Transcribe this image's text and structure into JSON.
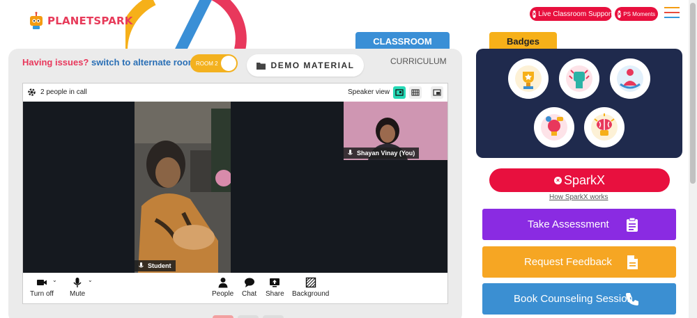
{
  "header": {
    "logo_text_1": "PLANET",
    "logo_text_2": "SPARK",
    "live_support_label": "Live Classroom Support",
    "ps_moments_label": "PS Moments",
    "close_glyph": "×"
  },
  "classroom": {
    "tab_label": "CLASSROOM",
    "issue_question": "Having issues?",
    "issue_action": "switch to alternate room",
    "room_toggle_label": "ROOM 2",
    "demo_material_label": "DEMO MATERIAL",
    "curriculum_label": "CURRICULUM"
  },
  "call": {
    "people_count_label": "2 people in call",
    "speaker_view_label": "Speaker view",
    "student_name": "Student",
    "teacher_name": "Shayan Vinay (You)",
    "controls": {
      "turn_off": "Turn off",
      "mute": "Mute",
      "people": "People",
      "chat": "Chat",
      "share": "Share",
      "background": "Background"
    }
  },
  "sidebar": {
    "badges_label": "Badges",
    "badge_icons": [
      "trophy-badge-icon",
      "fist-badge-icon",
      "meditation-badge-icon",
      "lightbulb-badge-icon",
      "brain-badge-icon"
    ],
    "sparkx_label": "SparkX",
    "sparkx_link": "How SparkX works",
    "take_assessment": "Take Assessment",
    "request_feedback": "Request Feedback",
    "book_counseling": "Book Counseling Session"
  },
  "colors": {
    "brand_red": "#e8103e",
    "classroom_blue": "#3a8fd6",
    "badges_yellow": "#f6b019",
    "badges_panel": "#1f2a4d",
    "assessment_purple": "#8a2be2",
    "feedback_orange": "#f6a623",
    "counsel_blue": "#3b8fd2",
    "active_view": "#26d9b6"
  }
}
